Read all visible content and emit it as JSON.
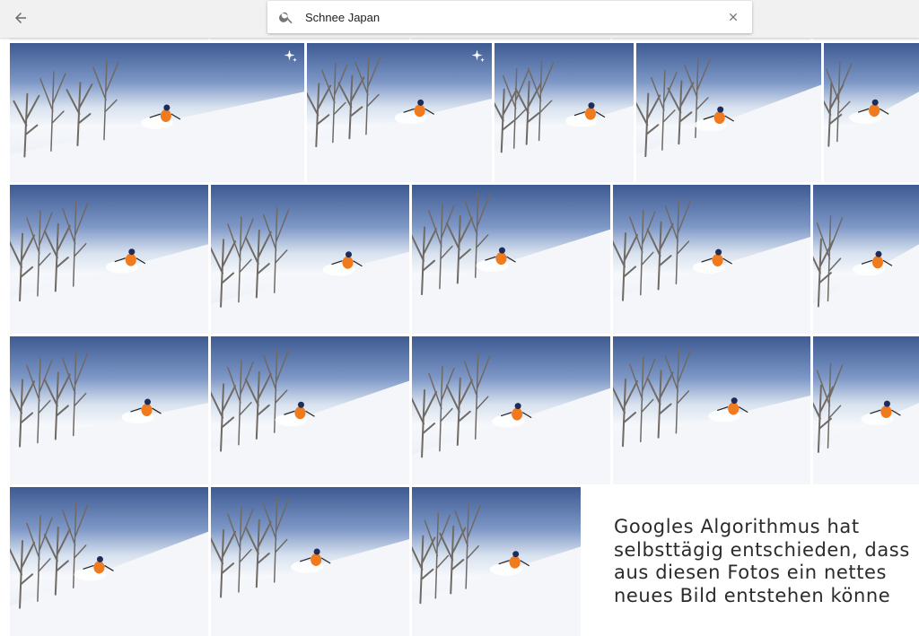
{
  "search": {
    "query": "Schnee Japan"
  },
  "photos": {
    "alt": "Skifahrer im Tiefschnee"
  },
  "caption": {
    "line1": "Googles Algorithmus hat",
    "line2": "selbsttägig entschieden, dass",
    "line3": "aus diesen Fotos ein nettes",
    "line4": "neues Bild entstehen könne"
  },
  "colors": {
    "sky_dark": "#3d5a92",
    "snow": "#f4f6f9",
    "skier_jacket": "#f07a1e",
    "topbar": "#f1f1f1",
    "caption_text": "#2b2b2b"
  },
  "icons": {
    "back": "arrow-left-icon",
    "search": "magnifier-icon",
    "clear": "close-x-icon",
    "auto_create": "sparkle-icon"
  }
}
